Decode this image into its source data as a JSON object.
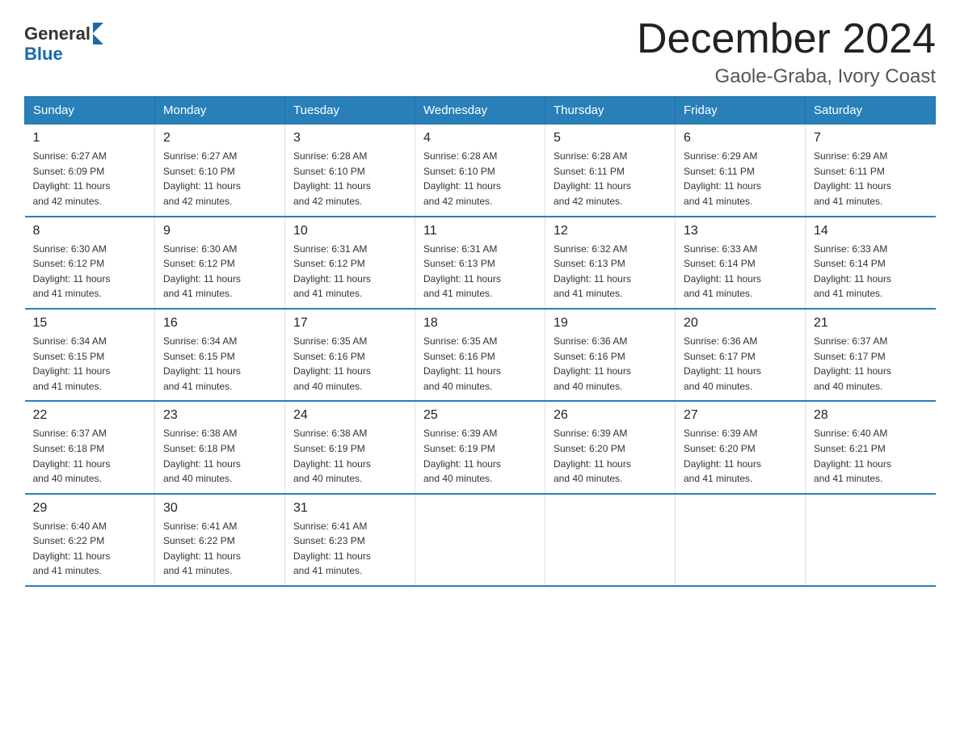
{
  "logo": {
    "text_general": "General",
    "text_blue": "Blue"
  },
  "header": {
    "month": "December 2024",
    "location": "Gaole-Graba, Ivory Coast"
  },
  "days_of_week": [
    "Sunday",
    "Monday",
    "Tuesday",
    "Wednesday",
    "Thursday",
    "Friday",
    "Saturday"
  ],
  "weeks": [
    [
      {
        "day": "1",
        "sunrise": "6:27 AM",
        "sunset": "6:09 PM",
        "daylight": "11 hours and 42 minutes."
      },
      {
        "day": "2",
        "sunrise": "6:27 AM",
        "sunset": "6:10 PM",
        "daylight": "11 hours and 42 minutes."
      },
      {
        "day": "3",
        "sunrise": "6:28 AM",
        "sunset": "6:10 PM",
        "daylight": "11 hours and 42 minutes."
      },
      {
        "day": "4",
        "sunrise": "6:28 AM",
        "sunset": "6:10 PM",
        "daylight": "11 hours and 42 minutes."
      },
      {
        "day": "5",
        "sunrise": "6:28 AM",
        "sunset": "6:11 PM",
        "daylight": "11 hours and 42 minutes."
      },
      {
        "day": "6",
        "sunrise": "6:29 AM",
        "sunset": "6:11 PM",
        "daylight": "11 hours and 41 minutes."
      },
      {
        "day": "7",
        "sunrise": "6:29 AM",
        "sunset": "6:11 PM",
        "daylight": "11 hours and 41 minutes."
      }
    ],
    [
      {
        "day": "8",
        "sunrise": "6:30 AM",
        "sunset": "6:12 PM",
        "daylight": "11 hours and 41 minutes."
      },
      {
        "day": "9",
        "sunrise": "6:30 AM",
        "sunset": "6:12 PM",
        "daylight": "11 hours and 41 minutes."
      },
      {
        "day": "10",
        "sunrise": "6:31 AM",
        "sunset": "6:12 PM",
        "daylight": "11 hours and 41 minutes."
      },
      {
        "day": "11",
        "sunrise": "6:31 AM",
        "sunset": "6:13 PM",
        "daylight": "11 hours and 41 minutes."
      },
      {
        "day": "12",
        "sunrise": "6:32 AM",
        "sunset": "6:13 PM",
        "daylight": "11 hours and 41 minutes."
      },
      {
        "day": "13",
        "sunrise": "6:33 AM",
        "sunset": "6:14 PM",
        "daylight": "11 hours and 41 minutes."
      },
      {
        "day": "14",
        "sunrise": "6:33 AM",
        "sunset": "6:14 PM",
        "daylight": "11 hours and 41 minutes."
      }
    ],
    [
      {
        "day": "15",
        "sunrise": "6:34 AM",
        "sunset": "6:15 PM",
        "daylight": "11 hours and 41 minutes."
      },
      {
        "day": "16",
        "sunrise": "6:34 AM",
        "sunset": "6:15 PM",
        "daylight": "11 hours and 41 minutes."
      },
      {
        "day": "17",
        "sunrise": "6:35 AM",
        "sunset": "6:16 PM",
        "daylight": "11 hours and 40 minutes."
      },
      {
        "day": "18",
        "sunrise": "6:35 AM",
        "sunset": "6:16 PM",
        "daylight": "11 hours and 40 minutes."
      },
      {
        "day": "19",
        "sunrise": "6:36 AM",
        "sunset": "6:16 PM",
        "daylight": "11 hours and 40 minutes."
      },
      {
        "day": "20",
        "sunrise": "6:36 AM",
        "sunset": "6:17 PM",
        "daylight": "11 hours and 40 minutes."
      },
      {
        "day": "21",
        "sunrise": "6:37 AM",
        "sunset": "6:17 PM",
        "daylight": "11 hours and 40 minutes."
      }
    ],
    [
      {
        "day": "22",
        "sunrise": "6:37 AM",
        "sunset": "6:18 PM",
        "daylight": "11 hours and 40 minutes."
      },
      {
        "day": "23",
        "sunrise": "6:38 AM",
        "sunset": "6:18 PM",
        "daylight": "11 hours and 40 minutes."
      },
      {
        "day": "24",
        "sunrise": "6:38 AM",
        "sunset": "6:19 PM",
        "daylight": "11 hours and 40 minutes."
      },
      {
        "day": "25",
        "sunrise": "6:39 AM",
        "sunset": "6:19 PM",
        "daylight": "11 hours and 40 minutes."
      },
      {
        "day": "26",
        "sunrise": "6:39 AM",
        "sunset": "6:20 PM",
        "daylight": "11 hours and 40 minutes."
      },
      {
        "day": "27",
        "sunrise": "6:39 AM",
        "sunset": "6:20 PM",
        "daylight": "11 hours and 41 minutes."
      },
      {
        "day": "28",
        "sunrise": "6:40 AM",
        "sunset": "6:21 PM",
        "daylight": "11 hours and 41 minutes."
      }
    ],
    [
      {
        "day": "29",
        "sunrise": "6:40 AM",
        "sunset": "6:22 PM",
        "daylight": "11 hours and 41 minutes."
      },
      {
        "day": "30",
        "sunrise": "6:41 AM",
        "sunset": "6:22 PM",
        "daylight": "11 hours and 41 minutes."
      },
      {
        "day": "31",
        "sunrise": "6:41 AM",
        "sunset": "6:23 PM",
        "daylight": "11 hours and 41 minutes."
      },
      null,
      null,
      null,
      null
    ]
  ],
  "labels": {
    "sunrise": "Sunrise:",
    "sunset": "Sunset:",
    "daylight": "Daylight:"
  }
}
